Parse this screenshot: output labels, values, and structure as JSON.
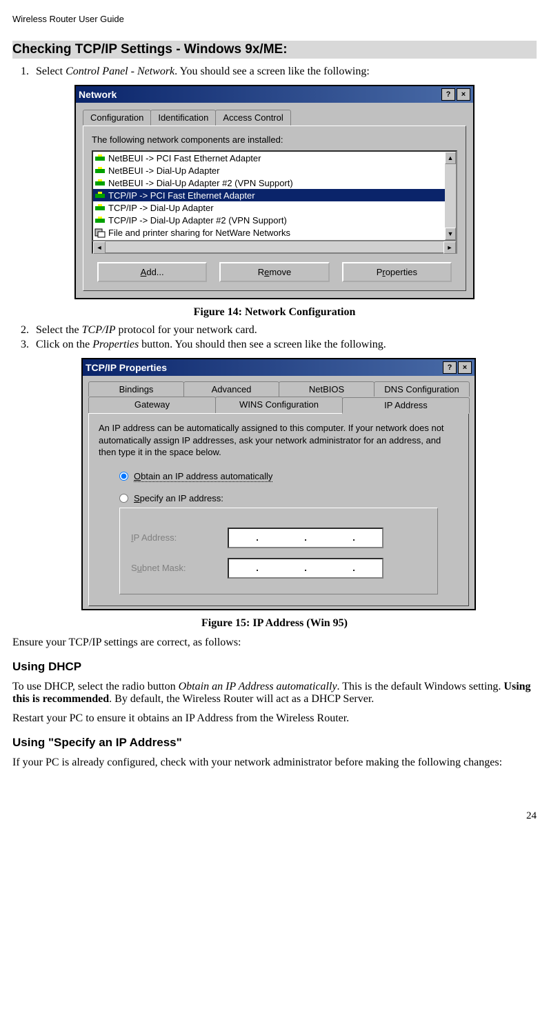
{
  "header": "Wireless Router User Guide",
  "section_heading": "Checking TCP/IP Settings - Windows 9x/ME:",
  "step1_pre": "Select ",
  "step1_em": "Control Panel - Network",
  "step1_post": ". You should see a screen like the following:",
  "network_window": {
    "title": "Network",
    "help_btn": "?",
    "close_btn": "×",
    "tabs": {
      "t1": "Configuration",
      "t2": "Identification",
      "t3": "Access Control"
    },
    "label": "The following network components are installed:",
    "items": [
      "NetBEUI -> PCI Fast Ethernet Adapter",
      "NetBEUI -> Dial-Up Adapter",
      "NetBEUI -> Dial-Up Adapter #2 (VPN Support)",
      "TCP/IP -> PCI Fast Ethernet Adapter",
      "TCP/IP -> Dial-Up Adapter",
      "TCP/IP -> Dial-Up Adapter #2 (VPN Support)",
      "File and printer sharing for NetWare Networks"
    ],
    "buttons": {
      "add": "Add...",
      "remove": "Remove",
      "props": "Properties"
    }
  },
  "fig14": "Figure 14: Network Configuration",
  "step2_pre": "Select the ",
  "step2_em": "TCP/IP",
  "step2_post": " protocol for your network card.",
  "step3_pre": "Click on the ",
  "step3_em": "Properties",
  "step3_post": " button. You should then see a screen like the following.",
  "tcpip_window": {
    "title": "TCP/IP Properties",
    "tabs_top": {
      "t1": "Bindings",
      "t2": "Advanced",
      "t3": "NetBIOS",
      "t4": "DNS Configuration"
    },
    "tabs_bottom": {
      "t1": "Gateway",
      "t2": "WINS Configuration",
      "t3": "IP Address"
    },
    "desc": "An IP address can be automatically assigned to this computer. If your network does not automatically assign IP addresses, ask your network administrator for an address, and then type it in the space below.",
    "radio1": "Obtain an IP address automatically",
    "radio2": "Specify an IP address:",
    "ip_label": "IP Address:",
    "mask_label": "Subnet Mask:"
  },
  "fig15": "Figure 15: IP Address (Win 95)",
  "ensure": "Ensure your TCP/IP settings are correct, as follows:",
  "dhcp_heading": "Using DHCP",
  "dhcp_p_pre": "To use DHCP, select the radio button ",
  "dhcp_p_em": "Obtain an IP Address automatically",
  "dhcp_p_mid": ". This is the default Windows setting. ",
  "dhcp_p_strong": "Using this is recommended",
  "dhcp_p_post": ". By default, the Wireless Router will act as a DHCP Server.",
  "dhcp_restart": "Restart your PC to ensure it obtains an IP Address from the Wireless Router.",
  "specify_heading": "Using \"Specify an IP Address\"",
  "specify_p": "If your PC is already configured, check with your network administrator before making the following changes:",
  "page": "24"
}
